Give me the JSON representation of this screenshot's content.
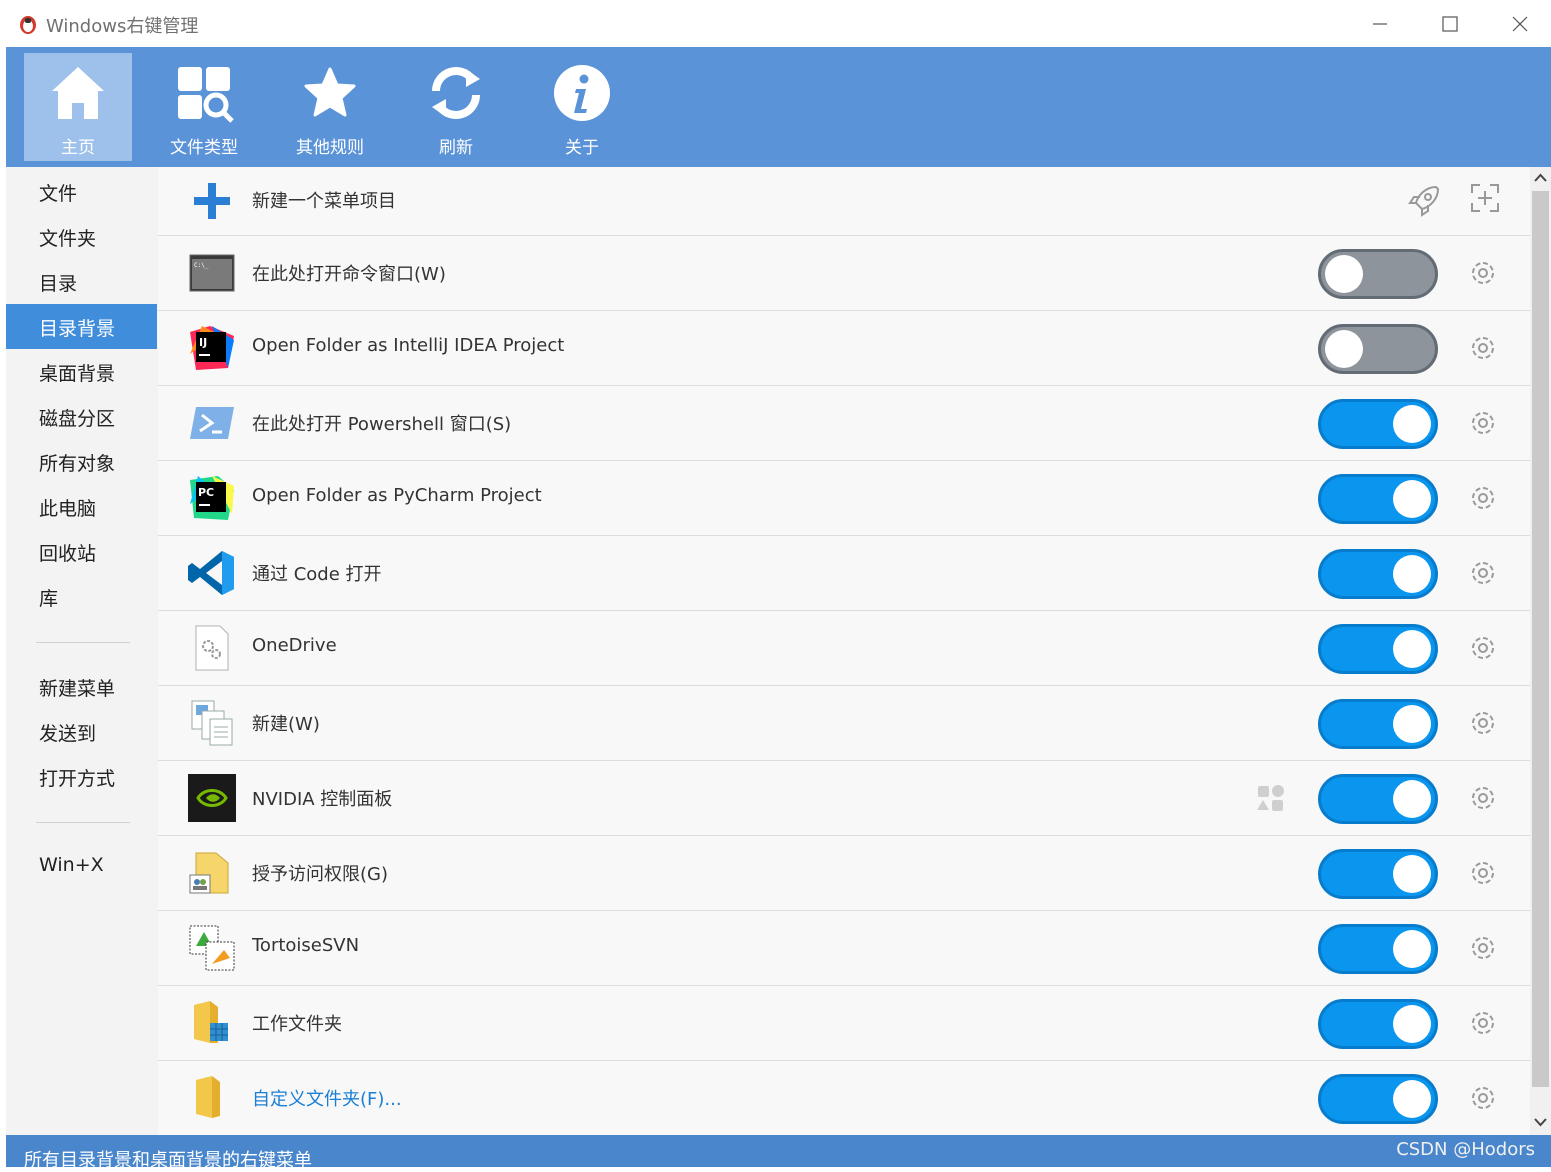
{
  "window": {
    "title": "Windows右键管理"
  },
  "toolbar": {
    "items": [
      {
        "label": "主页",
        "icon": "home-icon",
        "active": true
      },
      {
        "label": "文件类型",
        "icon": "file-types-icon"
      },
      {
        "label": "其他规则",
        "icon": "star-icon"
      },
      {
        "label": "刷新",
        "icon": "refresh-icon"
      },
      {
        "label": "关于",
        "icon": "info-icon"
      }
    ]
  },
  "sidebar": {
    "items": [
      {
        "label": "文件"
      },
      {
        "label": "文件夹"
      },
      {
        "label": "目录"
      },
      {
        "label": "目录背景",
        "active": true
      },
      {
        "label": "桌面背景"
      },
      {
        "label": "磁盘分区"
      },
      {
        "label": "所有对象"
      },
      {
        "label": "此电脑"
      },
      {
        "label": "回收站"
      },
      {
        "label": "库"
      },
      {
        "label": "新建菜单"
      },
      {
        "label": "发送到"
      },
      {
        "label": "打开方式"
      },
      {
        "label": "Win+X"
      }
    ]
  },
  "main": {
    "new_item_label": "新建一个菜单项目",
    "rows": [
      {
        "label": "在此处打开命令窗口(W)",
        "icon": "cmd-icon",
        "enabled": false
      },
      {
        "label": "Open Folder as IntelliJ IDEA Project",
        "icon": "intellij-icon",
        "enabled": false
      },
      {
        "label": "在此处打开 Powershell 窗口(S)",
        "icon": "powershell-icon",
        "enabled": true
      },
      {
        "label": "Open Folder as PyCharm Project",
        "icon": "pycharm-icon",
        "enabled": true
      },
      {
        "label": "通过 Code 打开",
        "icon": "vscode-icon",
        "enabled": true
      },
      {
        "label": "OneDrive",
        "icon": "onedrive-file-icon",
        "enabled": true
      },
      {
        "label": "新建(W)",
        "icon": "new-document-icon",
        "enabled": true
      },
      {
        "label": "NVIDIA 控制面板",
        "icon": "nvidia-icon",
        "enabled": true,
        "shell_ex_badge": true
      },
      {
        "label": "授予访问权限(G)",
        "icon": "share-access-icon",
        "enabled": true
      },
      {
        "label": "TortoiseSVN",
        "icon": "tortoisesvn-icon",
        "enabled": true
      },
      {
        "label": "工作文件夹",
        "icon": "work-folders-icon",
        "enabled": true
      },
      {
        "label": "自定义文件夹(F)...",
        "icon": "folder-icon",
        "enabled": true,
        "link": true
      }
    ]
  },
  "statusbar": {
    "text": "所有目录背景和桌面背景的右键菜单",
    "watermark": "CSDN @Hodors"
  },
  "colors": {
    "toolbar_bg": "#5b93d8",
    "toggle_on": "#0a96ef",
    "toggle_off": "#8d949b",
    "sidebar_active": "#3f8ddb"
  }
}
